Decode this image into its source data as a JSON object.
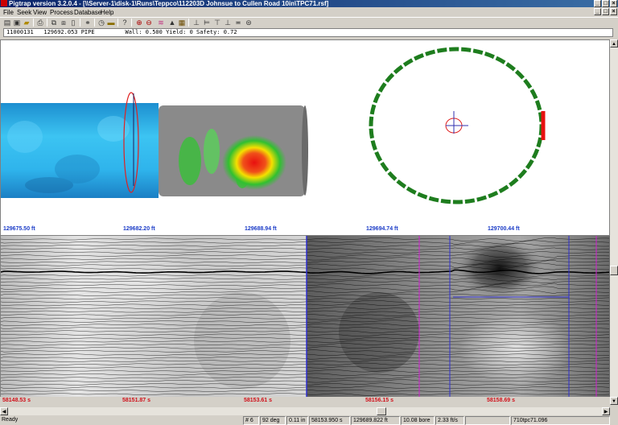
{
  "window": {
    "title": "Pigtrap version 3.2.0.4 - [\\\\Server-1\\disk-1\\Runs\\Teppco\\112203D Johnsue to Cullen Road 10in\\TPC71.rsf]",
    "controls": [
      "minimize",
      "maximize",
      "close"
    ]
  },
  "menu": {
    "items": [
      {
        "label": "File",
        "underline": "F"
      },
      {
        "label": "Seek",
        "underline": ""
      },
      {
        "label": "View",
        "underline": ""
      },
      {
        "label": "Process",
        "underline": ""
      },
      {
        "label": "Database",
        "underline": ""
      },
      {
        "label": "Help",
        "underline": "H"
      }
    ]
  },
  "toolbar": {
    "icons": [
      "open-icon",
      "save-icon",
      "folder-icon",
      "print-icon",
      "copy-icon",
      "paste-icon",
      "document-icon",
      "binoculars-icon",
      "clock-icon",
      "measure-icon",
      "help-icon",
      "zoom-in-icon",
      "zoom-out-icon",
      "waveform-icon",
      "triangle-icon",
      "grid-icon",
      "align-icon",
      "align-icon",
      "align-icon",
      "align-icon",
      "align-icon",
      "wave-icon"
    ]
  },
  "info": {
    "text": "11000131   129692.053 PIPE         Wall: 0.500 Yield: 0 Safety: 0.72"
  },
  "upper_panel": {
    "ft_labels": [
      "129675.50 ft",
      "129682.20 ft",
      "129688.94 ft",
      "129694.74 ft",
      "129700.44 ft"
    ],
    "colors": {
      "pipe_blue": "#2fb4ec",
      "pipe_grey": "#8a8a8a",
      "anomaly_red": "#e81010",
      "ring_green": "#1e7d1e",
      "ft_label": "#1a3bc7"
    }
  },
  "lower_panel": {
    "s_labels": [
      "58148.53 s",
      "58151.87 s",
      "58153.61 s",
      "58156.15 s",
      "58158.69 s"
    ],
    "colors": {
      "s_label": "#d0101a",
      "trace": "#000000",
      "marker_blue": "#3030d0",
      "marker_magenta": "#d020d0"
    }
  },
  "status": {
    "ready": "Ready",
    "cells": [
      "# 6",
      "92 deg",
      "0.11 in",
      "58153.950 s",
      "129689.822 ft",
      "10.08 bore",
      "2.33 ft/s",
      "",
      "710tpc71.096"
    ]
  }
}
